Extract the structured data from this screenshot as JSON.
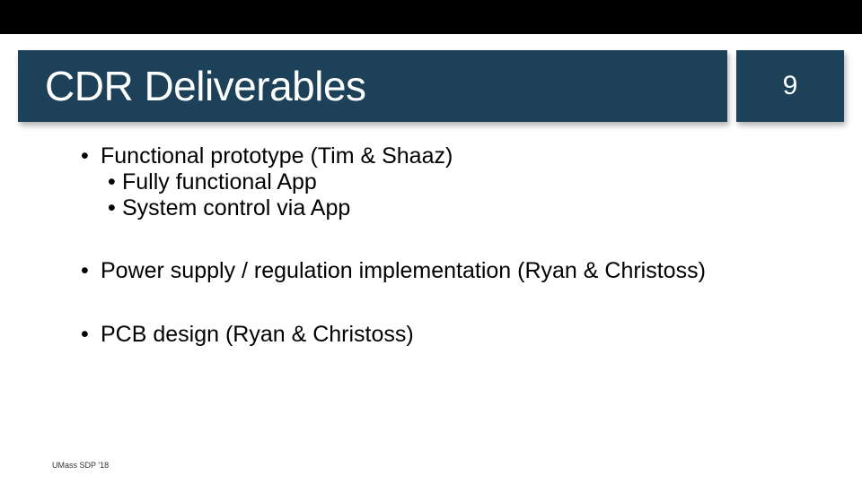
{
  "header": {
    "title": "CDR Deliverables",
    "page_number": "9"
  },
  "bullets": {
    "b1": "Functional prototype (Tim & Shaaz)",
    "b1a": "Fully functional App",
    "b1b": "System control via App",
    "b2": "Power supply / regulation implementation (Ryan & Christoss)",
    "b3": "PCB design (Ryan & Christoss)"
  },
  "footer": "UMass SDP '18",
  "glyphs": {
    "dot": "•"
  }
}
